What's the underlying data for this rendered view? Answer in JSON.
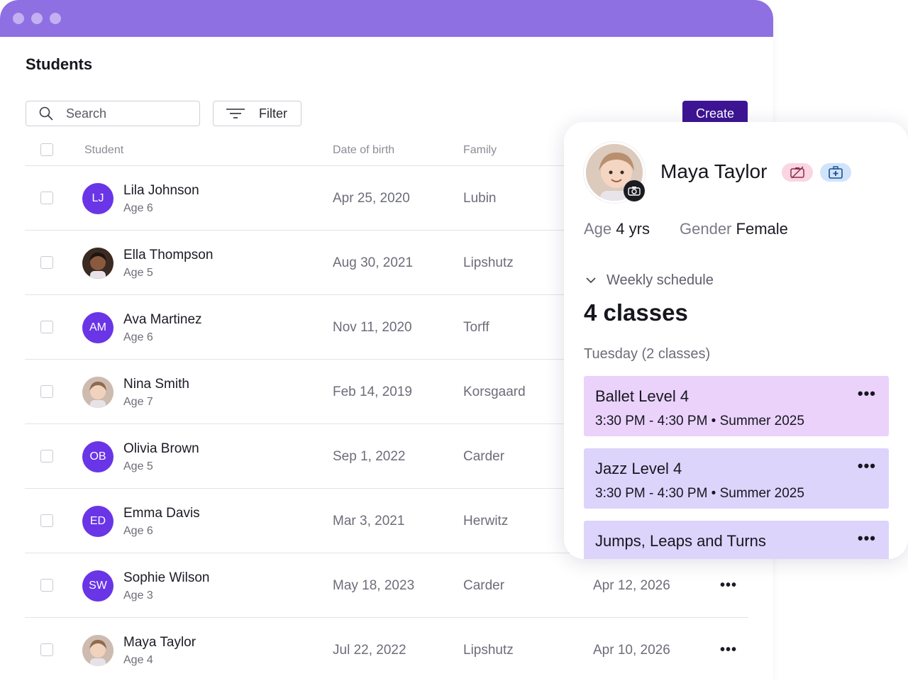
{
  "page": {
    "title": "Students"
  },
  "toolbar": {
    "search_placeholder": "Search",
    "filter_label": "Filter",
    "create_label": "Create"
  },
  "table": {
    "columns": [
      "Student",
      "Date of birth",
      "Family"
    ],
    "rows": [
      {
        "initials": "LJ",
        "name": "Lila Johnson",
        "age": "Age 6",
        "dob": "Apr 25, 2020",
        "family": "Lubin",
        "date": ""
      },
      {
        "initials": "",
        "name": "Ella Thompson",
        "age": "Age 5",
        "dob": "Aug 30, 2021",
        "family": "Lipshutz",
        "date": ""
      },
      {
        "initials": "AM",
        "name": "Ava Martinez",
        "age": "Age 6",
        "dob": "Nov 11, 2020",
        "family": "Torff",
        "date": ""
      },
      {
        "initials": "",
        "name": "Nina Smith",
        "age": "Age 7",
        "dob": "Feb 14, 2019",
        "family": "Korsgaard",
        "date": ""
      },
      {
        "initials": "OB",
        "name": "Olivia Brown",
        "age": "Age 5",
        "dob": "Sep 1, 2022",
        "family": "Carder",
        "date": ""
      },
      {
        "initials": "ED",
        "name": "Emma Davis",
        "age": "Age 6",
        "dob": "Mar 3, 2021",
        "family": "Herwitz",
        "date": ""
      },
      {
        "initials": "SW",
        "name": "Sophie Wilson",
        "age": "Age 3",
        "dob": "May 18, 2023",
        "family": "Carder",
        "date": "Apr 12, 2026"
      },
      {
        "initials": "",
        "name": "Maya Taylor",
        "age": "Age 4",
        "dob": "Jul 22, 2022",
        "family": "Lipshutz",
        "date": "Apr 10, 2026"
      }
    ]
  },
  "panel": {
    "name": "Maya Taylor",
    "age_label": "Age",
    "age_value": "4 yrs",
    "gender_label": "Gender",
    "gender_value": "Female",
    "schedule_label": "Weekly schedule",
    "classes_count": "4 classes",
    "day_label": "Tuesday (2 classes)",
    "classes": [
      {
        "title": "Ballet Level 4",
        "sub": "3:30 PM - 4:30 PM • Summer 2025",
        "color": "#ead2fb"
      },
      {
        "title": "Jazz Level 4",
        "sub": "3:30 PM - 4:30 PM • Summer 2025",
        "color": "#dcd4fb"
      },
      {
        "title": "Jumps, Leaps and Turns",
        "sub": "",
        "color": "#dcd4fb"
      }
    ]
  },
  "colors": {
    "accent": "#8e70e2",
    "primary": "#3d1594",
    "avatar": "#6a35e6"
  },
  "more_glyph": "•••"
}
